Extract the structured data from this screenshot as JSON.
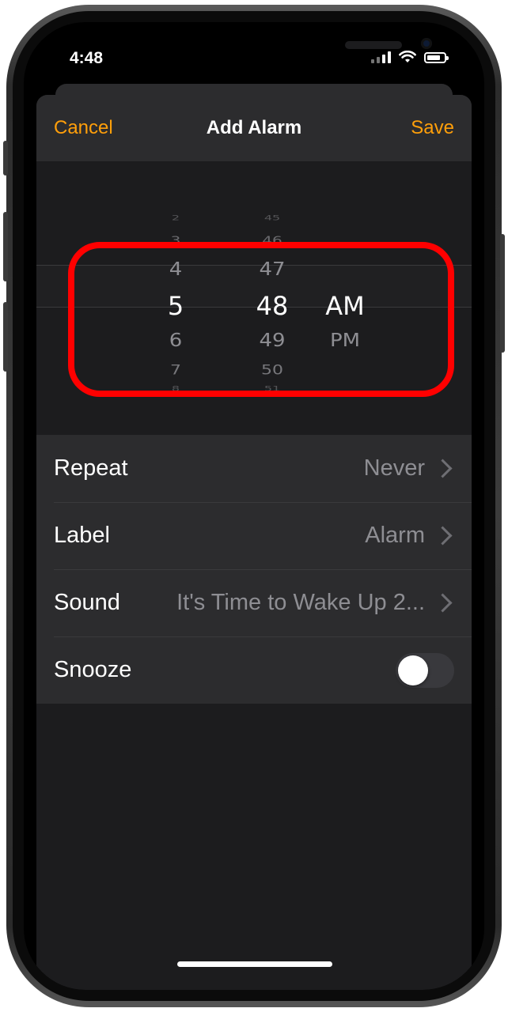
{
  "status_bar": {
    "time": "4:48"
  },
  "nav": {
    "cancel_label": "Cancel",
    "title": "Add Alarm",
    "save_label": "Save"
  },
  "picker": {
    "hours": [
      "2",
      "3",
      "4",
      "5",
      "6",
      "7",
      "8"
    ],
    "minutes": [
      "45",
      "46",
      "47",
      "48",
      "49",
      "50",
      "51"
    ],
    "periods": [
      "AM",
      "PM"
    ],
    "selected_hour": "5",
    "selected_minute": "48",
    "selected_period": "AM"
  },
  "options": {
    "repeat": {
      "label": "Repeat",
      "value": "Never"
    },
    "label": {
      "label": "Label",
      "value": "Alarm"
    },
    "sound": {
      "label": "Sound",
      "value": "It's Time to Wake Up 2..."
    },
    "snooze": {
      "label": "Snooze",
      "enabled": false
    }
  },
  "colors": {
    "accent": "#ff9f0a",
    "highlight": "#ff0000",
    "background": "#1c1c1e",
    "cell": "#2c2c2e"
  }
}
